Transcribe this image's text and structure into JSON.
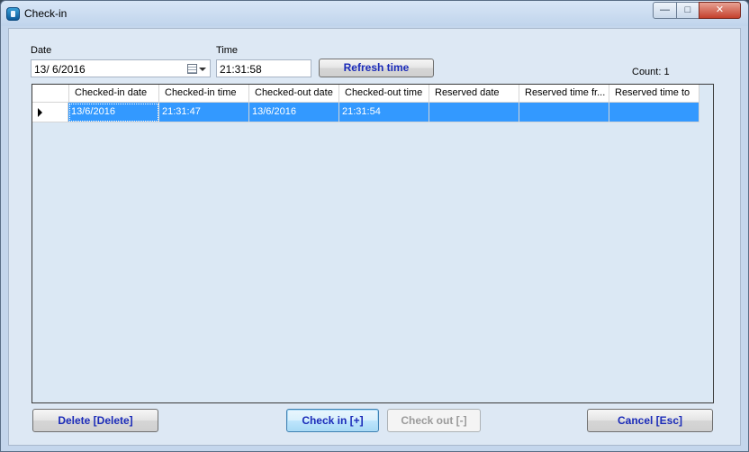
{
  "window": {
    "title": "Check-in",
    "minimize_glyph": "—",
    "maximize_glyph": "□",
    "close_glyph": "✕"
  },
  "form": {
    "date_label": "Date",
    "date_value": "13/  6/2016",
    "time_label": "Time",
    "time_value": "21:31:58",
    "refresh_label": "Refresh time",
    "count_text": "Count: 1"
  },
  "grid": {
    "columns": [
      "Checked-in date",
      "Checked-in time",
      "Checked-out date",
      "Checked-out time",
      "Reserved date",
      "Reserved time fr...",
      "Reserved time to"
    ],
    "rows": [
      [
        "13/6/2016",
        "21:31:47",
        "13/6/2016",
        "21:31:54",
        "",
        "",
        ""
      ]
    ]
  },
  "buttons": {
    "delete": "Delete [Delete]",
    "check_in": "Check in [+]",
    "check_out": "Check out [-]",
    "cancel": "Cancel [Esc]"
  },
  "colors": {
    "selection": "#3399ff",
    "button_text": "#1a2ab8",
    "disabled_text": "#9a9a9a"
  }
}
